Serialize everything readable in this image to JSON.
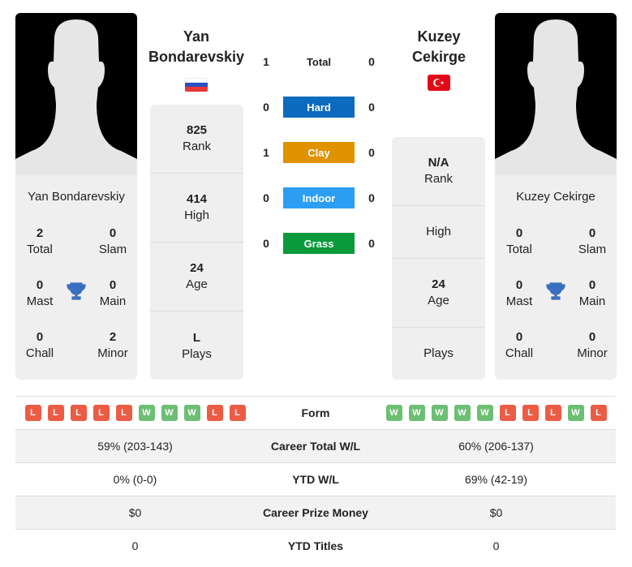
{
  "player1": {
    "name": "Yan Bondarevskiy",
    "title_lines": [
      "Yan",
      "Bondarevskiy"
    ],
    "flag": "russia-flag",
    "titles": {
      "total": "2",
      "total_label": "Total",
      "slam": "0",
      "slam_label": "Slam",
      "mast": "0",
      "mast_label": "Mast",
      "main": "0",
      "main_label": "Main",
      "chall": "0",
      "chall_label": "Chall",
      "minor": "2",
      "minor_label": "Minor"
    },
    "info": [
      {
        "value": "825",
        "label": "Rank"
      },
      {
        "value": "414",
        "label": "High"
      },
      {
        "value": "24",
        "label": "Age"
      },
      {
        "value": "L",
        "label": "Plays"
      }
    ],
    "form": [
      "L",
      "L",
      "L",
      "L",
      "L",
      "W",
      "W",
      "W",
      "L",
      "L"
    ]
  },
  "player2": {
    "name": "Kuzey Cekirge",
    "title_lines": [
      "Kuzey",
      "Cekirge"
    ],
    "flag": "turkey-flag",
    "titles": {
      "total": "0",
      "total_label": "Total",
      "slam": "0",
      "slam_label": "Slam",
      "mast": "0",
      "mast_label": "Mast",
      "main": "0",
      "main_label": "Main",
      "chall": "0",
      "chall_label": "Chall",
      "minor": "0",
      "minor_label": "Minor"
    },
    "info": [
      {
        "value": "N/A",
        "label": "Rank"
      },
      {
        "value": "",
        "label": "High"
      },
      {
        "value": "24",
        "label": "Age"
      },
      {
        "value": "",
        "label": "Plays"
      }
    ],
    "form": [
      "W",
      "W",
      "W",
      "W",
      "W",
      "L",
      "L",
      "L",
      "W",
      "L"
    ]
  },
  "h2h": [
    {
      "label": "Total",
      "p1": "1",
      "p2": "0",
      "color": null
    },
    {
      "label": "Hard",
      "p1": "0",
      "p2": "0",
      "color": "#0a6bbf"
    },
    {
      "label": "Clay",
      "p1": "1",
      "p2": "0",
      "color": "#e09200"
    },
    {
      "label": "Indoor",
      "p1": "0",
      "p2": "0",
      "color": "#2b9ef3"
    },
    {
      "label": "Grass",
      "p1": "0",
      "p2": "0",
      "color": "#0a9a3c"
    }
  ],
  "table": {
    "form_label": "Form",
    "rows": [
      {
        "label": "Career Total W/L",
        "p1": "59% (203-143)",
        "p2": "60% (206-137)"
      },
      {
        "label": "YTD W/L",
        "p1": "0% (0-0)",
        "p2": "69% (42-19)"
      },
      {
        "label": "Career Prize Money",
        "p1": "$0",
        "p2": "$0"
      },
      {
        "label": "YTD Titles",
        "p1": "0",
        "p2": "0"
      }
    ]
  },
  "colors": {
    "trophy": "#3a6fc0",
    "win": "#6cbf73",
    "loss": "#ec5c44"
  }
}
